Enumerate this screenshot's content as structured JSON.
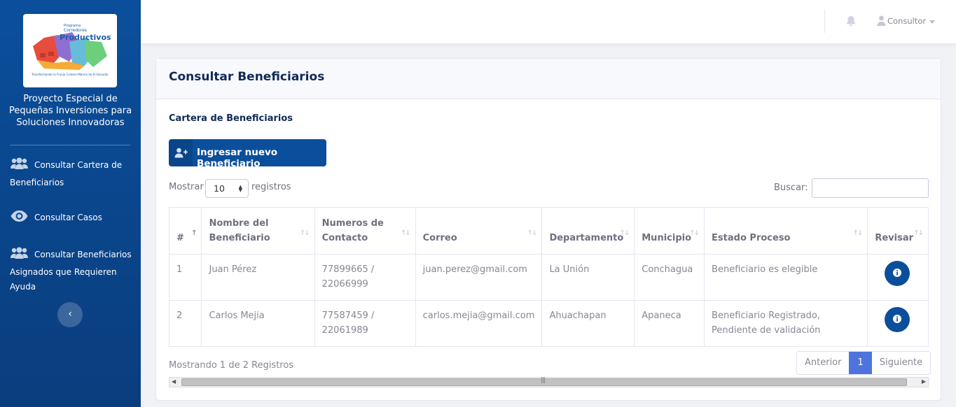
{
  "sidebar": {
    "logo": {
      "line1": "Programa",
      "line2": "Corredores",
      "line3": "Productivos",
      "tagline": "Transformando la Franja Costero-Marina de El Salvador"
    },
    "project_title": "Proyecto Especial de Pequeñas Inversiones para Soluciones Innovadoras",
    "items": [
      {
        "label": "Consultar Cartera de Beneficiarios",
        "icon": "users-icon"
      },
      {
        "label": "Consultar Casos",
        "icon": "eye-icon"
      },
      {
        "label": "Consultar Beneficiarios Asignados que Requieren Ayuda",
        "icon": "users-icon"
      }
    ],
    "collapse_glyph": "‹"
  },
  "topbar": {
    "user_label": "Consultor"
  },
  "page": {
    "title": "Consultar Beneficiarios",
    "subtitle": "Cartera de Beneficiarios",
    "new_button_label": "Ingresar nuevo Beneficiario",
    "show_label": "Mostrar",
    "page_size": "10",
    "show_suffix": "registros",
    "search_label": "Buscar:",
    "search_value": ""
  },
  "table": {
    "headers": [
      "#",
      "Nombre del Beneficiario",
      "Numeros de Contacto",
      "Correo",
      "Departamento",
      "Municipio",
      "Estado Proceso",
      "Revisar"
    ],
    "rows": [
      {
        "num": "1",
        "name": "Juan Pérez",
        "contact": "77899665 / 22066999",
        "email": "juan.perez@gmail.com",
        "dept": "La Unión",
        "muni": "Conchagua",
        "status": "Beneficiario es elegible"
      },
      {
        "num": "2",
        "name": "Carlos Mejia",
        "contact": "77587459 / 22061989",
        "email": "carlos.mejia@gmail.com",
        "dept": "Ahuachapan",
        "muni": "Apaneca",
        "status": "Beneficiario Registrado, Pendiente de validación"
      }
    ]
  },
  "footer": {
    "info": "Mostrando 1 de 2 Registros",
    "prev": "Anterior",
    "current_page": "1",
    "next": "Siguiente"
  },
  "colors": {
    "brand": "#0b4f9c",
    "pager_active": "#4e73df"
  }
}
